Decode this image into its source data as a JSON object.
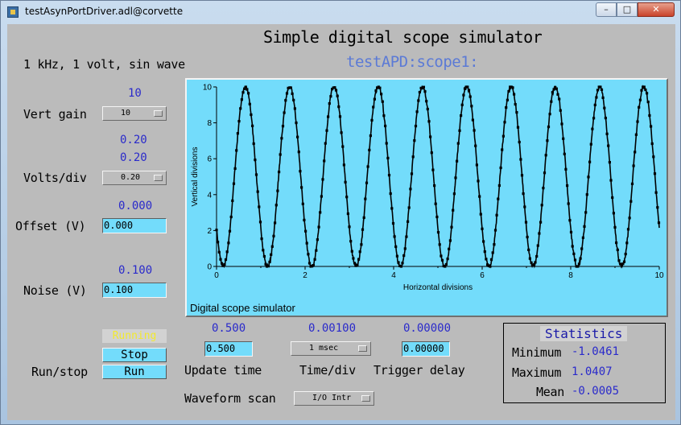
{
  "window": {
    "title": "testAsynPortDriver.adl@corvette",
    "min": "–",
    "max": "□",
    "close": "✕"
  },
  "header": {
    "title": "Simple digital scope simulator",
    "pv": "testAPD:scope1:",
    "description": "1 kHz, 1 volt, sin wave"
  },
  "vert_gain": {
    "label": "Vert gain",
    "readback": "10",
    "menu": "10"
  },
  "volts_div": {
    "label": "Volts/div",
    "readback": "0.20",
    "readback2": "0.20",
    "menu": "0.20"
  },
  "offset": {
    "label": "Offset (V)",
    "readback": "0.000",
    "entry": "0.000"
  },
  "noise": {
    "label": "Noise (V)",
    "readback": "0.100",
    "entry": "0.100"
  },
  "run": {
    "label": "Run/stop",
    "status": "Running",
    "stop": "Stop",
    "run": "Run"
  },
  "update_time": {
    "label": "Update time",
    "readback": "0.500",
    "entry": "0.500"
  },
  "time_div": {
    "label": "Time/div",
    "readback": "0.00100",
    "menu": "1 msec"
  },
  "trigger_delay": {
    "label": "Trigger delay",
    "readback": "0.00000",
    "entry": "0.00000"
  },
  "waveform_scan": {
    "label": "Waveform scan",
    "menu": "I/O Intr"
  },
  "statistics": {
    "title": "Statistics",
    "min_label": "Minimum",
    "min": "-1.0461",
    "max_label": "Maximum",
    "max": "1.0407",
    "mean_label": "Mean",
    "mean": "-0.0005"
  },
  "plot": {
    "title": "Digital scope simulator",
    "xlabel": "Horizontal divisions",
    "ylabel": "Vertical divisions"
  },
  "chart_data": {
    "type": "scatter",
    "xlabel": "Horizontal divisions",
    "ylabel": "Vertical divisions",
    "xlim": [
      0,
      10
    ],
    "ylim": [
      0,
      10
    ],
    "xticks": [
      "0",
      "2",
      "4",
      "6",
      "8",
      "10"
    ],
    "yticks": [
      "0",
      "2",
      "4",
      "6",
      "8",
      "10"
    ],
    "waveform": {
      "cycles": 10,
      "center": 5,
      "amplitude": 5,
      "noise": 0.1,
      "phase_deg": 215,
      "points": 1000
    }
  }
}
